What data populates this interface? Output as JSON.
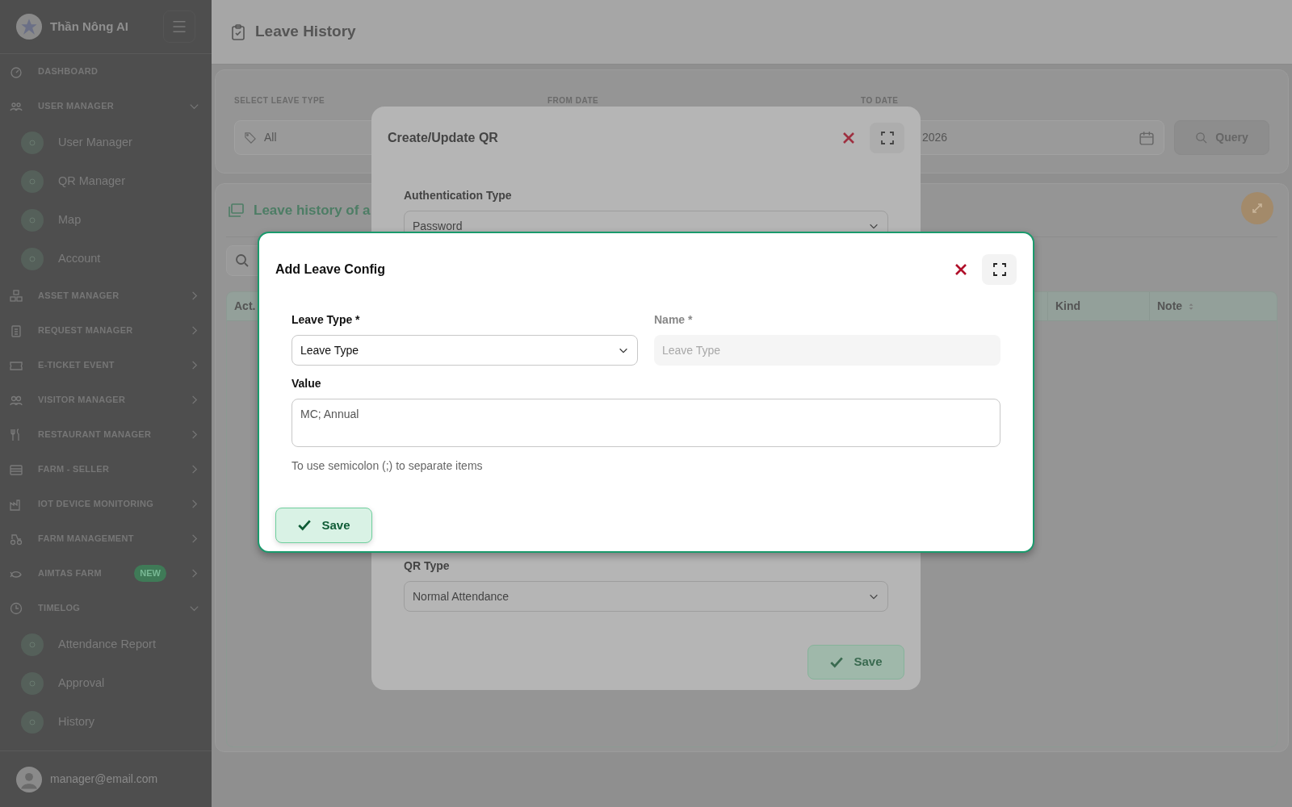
{
  "sidebar": {
    "brand": "Thần Nông AI",
    "items": [
      {
        "label": "DASHBOARD",
        "kind": "link"
      },
      {
        "label": "USER MANAGER",
        "kind": "section",
        "expanded": true,
        "children": [
          {
            "label": "User Manager"
          },
          {
            "label": "QR Manager"
          },
          {
            "label": "Map"
          },
          {
            "label": "Account"
          }
        ]
      },
      {
        "label": "ASSET MANAGER",
        "kind": "section",
        "expanded": false
      },
      {
        "label": "REQUEST MANAGER",
        "kind": "section",
        "expanded": false
      },
      {
        "label": "E-TICKET EVENT",
        "kind": "section",
        "expanded": false
      },
      {
        "label": "VISITOR MANAGER",
        "kind": "section",
        "expanded": false
      },
      {
        "label": "RESTAURANT MANAGER",
        "kind": "section",
        "expanded": false
      },
      {
        "label": "FARM - SELLER",
        "kind": "section",
        "expanded": false
      },
      {
        "label": "IOT DEVICE MONITORING",
        "kind": "section",
        "expanded": false
      },
      {
        "label": "FARM MANAGEMENT",
        "kind": "section",
        "expanded": false
      },
      {
        "label": "AIMTAS FARM",
        "kind": "section",
        "expanded": false,
        "badge": "NEW"
      },
      {
        "label": "TIMELOG",
        "kind": "section",
        "expanded": true,
        "children": [
          {
            "label": "Attendance Report"
          },
          {
            "label": "Approval"
          },
          {
            "label": "History"
          }
        ]
      }
    ],
    "user_email": "manager@email.com"
  },
  "header": {
    "title": "Leave History"
  },
  "filters": [
    {
      "label": "SELECT LEAVE TYPE",
      "value": "All"
    },
    {
      "label": "FROM DATE"
    },
    {
      "label": "TO DATE",
      "value": "2026"
    }
  ],
  "query_button": "Query",
  "history_card": {
    "title": "Leave history of a",
    "columns": [
      "Act.",
      "Kind",
      "Note"
    ]
  },
  "qr_modal": {
    "title": "Create/Update QR",
    "fields": [
      {
        "label": "Authentication Type",
        "value": "Password"
      },
      {
        "label": "QR Type",
        "value": "Normal Attendance"
      }
    ],
    "save": "Save"
  },
  "leave_modal": {
    "title": "Add Leave Config",
    "leave_type": {
      "label": "Leave Type",
      "required": "*",
      "value": "Leave Type"
    },
    "name": {
      "label": "Name",
      "required": "*",
      "placeholder": "Leave Type"
    },
    "value_field": {
      "label": "Value",
      "value": "MC; Annual"
    },
    "hint": "To use semicolon (;) to separate items",
    "save": "Save"
  }
}
